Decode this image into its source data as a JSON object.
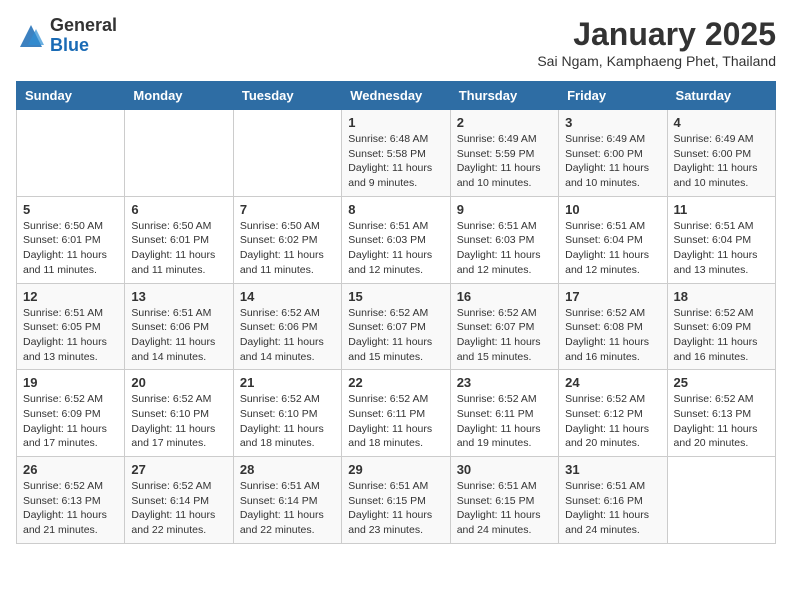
{
  "logo": {
    "general": "General",
    "blue": "Blue"
  },
  "header": {
    "month": "January 2025",
    "location": "Sai Ngam, Kamphaeng Phet, Thailand"
  },
  "weekdays": [
    "Sunday",
    "Monday",
    "Tuesday",
    "Wednesday",
    "Thursday",
    "Friday",
    "Saturday"
  ],
  "weeks": [
    [
      {
        "day": "",
        "info": ""
      },
      {
        "day": "",
        "info": ""
      },
      {
        "day": "",
        "info": ""
      },
      {
        "day": "1",
        "info": "Sunrise: 6:48 AM\nSunset: 5:58 PM\nDaylight: 11 hours and 9 minutes."
      },
      {
        "day": "2",
        "info": "Sunrise: 6:49 AM\nSunset: 5:59 PM\nDaylight: 11 hours and 10 minutes."
      },
      {
        "day": "3",
        "info": "Sunrise: 6:49 AM\nSunset: 6:00 PM\nDaylight: 11 hours and 10 minutes."
      },
      {
        "day": "4",
        "info": "Sunrise: 6:49 AM\nSunset: 6:00 PM\nDaylight: 11 hours and 10 minutes."
      }
    ],
    [
      {
        "day": "5",
        "info": "Sunrise: 6:50 AM\nSunset: 6:01 PM\nDaylight: 11 hours and 11 minutes."
      },
      {
        "day": "6",
        "info": "Sunrise: 6:50 AM\nSunset: 6:01 PM\nDaylight: 11 hours and 11 minutes."
      },
      {
        "day": "7",
        "info": "Sunrise: 6:50 AM\nSunset: 6:02 PM\nDaylight: 11 hours and 11 minutes."
      },
      {
        "day": "8",
        "info": "Sunrise: 6:51 AM\nSunset: 6:03 PM\nDaylight: 11 hours and 12 minutes."
      },
      {
        "day": "9",
        "info": "Sunrise: 6:51 AM\nSunset: 6:03 PM\nDaylight: 11 hours and 12 minutes."
      },
      {
        "day": "10",
        "info": "Sunrise: 6:51 AM\nSunset: 6:04 PM\nDaylight: 11 hours and 12 minutes."
      },
      {
        "day": "11",
        "info": "Sunrise: 6:51 AM\nSunset: 6:04 PM\nDaylight: 11 hours and 13 minutes."
      }
    ],
    [
      {
        "day": "12",
        "info": "Sunrise: 6:51 AM\nSunset: 6:05 PM\nDaylight: 11 hours and 13 minutes."
      },
      {
        "day": "13",
        "info": "Sunrise: 6:51 AM\nSunset: 6:06 PM\nDaylight: 11 hours and 14 minutes."
      },
      {
        "day": "14",
        "info": "Sunrise: 6:52 AM\nSunset: 6:06 PM\nDaylight: 11 hours and 14 minutes."
      },
      {
        "day": "15",
        "info": "Sunrise: 6:52 AM\nSunset: 6:07 PM\nDaylight: 11 hours and 15 minutes."
      },
      {
        "day": "16",
        "info": "Sunrise: 6:52 AM\nSunset: 6:07 PM\nDaylight: 11 hours and 15 minutes."
      },
      {
        "day": "17",
        "info": "Sunrise: 6:52 AM\nSunset: 6:08 PM\nDaylight: 11 hours and 16 minutes."
      },
      {
        "day": "18",
        "info": "Sunrise: 6:52 AM\nSunset: 6:09 PM\nDaylight: 11 hours and 16 minutes."
      }
    ],
    [
      {
        "day": "19",
        "info": "Sunrise: 6:52 AM\nSunset: 6:09 PM\nDaylight: 11 hours and 17 minutes."
      },
      {
        "day": "20",
        "info": "Sunrise: 6:52 AM\nSunset: 6:10 PM\nDaylight: 11 hours and 17 minutes."
      },
      {
        "day": "21",
        "info": "Sunrise: 6:52 AM\nSunset: 6:10 PM\nDaylight: 11 hours and 18 minutes."
      },
      {
        "day": "22",
        "info": "Sunrise: 6:52 AM\nSunset: 6:11 PM\nDaylight: 11 hours and 18 minutes."
      },
      {
        "day": "23",
        "info": "Sunrise: 6:52 AM\nSunset: 6:11 PM\nDaylight: 11 hours and 19 minutes."
      },
      {
        "day": "24",
        "info": "Sunrise: 6:52 AM\nSunset: 6:12 PM\nDaylight: 11 hours and 20 minutes."
      },
      {
        "day": "25",
        "info": "Sunrise: 6:52 AM\nSunset: 6:13 PM\nDaylight: 11 hours and 20 minutes."
      }
    ],
    [
      {
        "day": "26",
        "info": "Sunrise: 6:52 AM\nSunset: 6:13 PM\nDaylight: 11 hours and 21 minutes."
      },
      {
        "day": "27",
        "info": "Sunrise: 6:52 AM\nSunset: 6:14 PM\nDaylight: 11 hours and 22 minutes."
      },
      {
        "day": "28",
        "info": "Sunrise: 6:51 AM\nSunset: 6:14 PM\nDaylight: 11 hours and 22 minutes."
      },
      {
        "day": "29",
        "info": "Sunrise: 6:51 AM\nSunset: 6:15 PM\nDaylight: 11 hours and 23 minutes."
      },
      {
        "day": "30",
        "info": "Sunrise: 6:51 AM\nSunset: 6:15 PM\nDaylight: 11 hours and 24 minutes."
      },
      {
        "day": "31",
        "info": "Sunrise: 6:51 AM\nSunset: 6:16 PM\nDaylight: 11 hours and 24 minutes."
      },
      {
        "day": "",
        "info": ""
      }
    ]
  ]
}
